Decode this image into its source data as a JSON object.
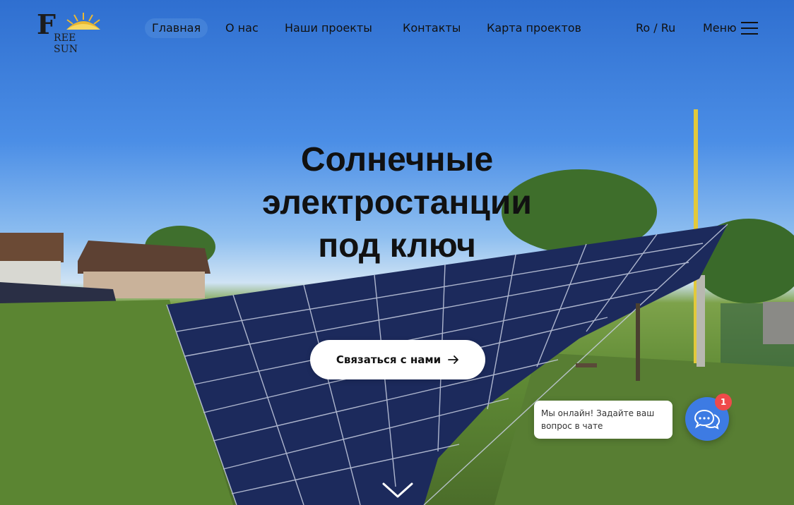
{
  "brand": {
    "logo_text": "REE SUN",
    "logo_initial": "F"
  },
  "nav": {
    "items": [
      {
        "label": "Главная",
        "active": true
      },
      {
        "label": "О нас",
        "active": false
      },
      {
        "label": "Наши проекты",
        "active": false
      },
      {
        "label": "Контакты",
        "active": false
      },
      {
        "label": "Карта проектов",
        "active": false
      }
    ],
    "lang": "Ro / Ru",
    "menu_label": "Меню"
  },
  "hero": {
    "headline_lines": [
      "Солнечные",
      "электростанции",
      "под ключ"
    ],
    "cta_label": "Связаться с нами",
    "cta_icon": "arrow-right-icon",
    "scroll_icon": "chevron-down-icon"
  },
  "chat": {
    "message": "Мы онлайн! Задайте ваш вопрос в чате",
    "badge_count": "1",
    "icon": "chat-bubbles-icon"
  },
  "colors": {
    "accent": "#3d7be3",
    "badge": "#ef4a4a",
    "cta_bg": "#ffffff",
    "text": "#111111"
  }
}
